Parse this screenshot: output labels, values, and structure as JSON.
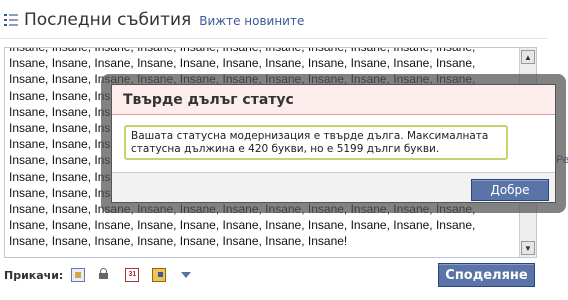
{
  "header": {
    "title": "Последни събития",
    "newest_link": "Вижте новините"
  },
  "composer": {
    "textarea_value": "Insane, Insane, Insane, Insane, Insane, Insane, Insane, Insane, Insane, Insane, Insane, Insane, Insane, Insane, Insane, Insane, Insane, Insane, Insane, Insane, Insane, Insane, Insane, Insane, Insane, Insane, Insane, Insane, Insane, Insane, Insane, Insane, Insane, Insane, Insane, Insane, Insane, Insane, Insane, Insane, Insane, Insane, Insane, Insane, Insane, Insane, Insane, Insane, Insane, Insane, Insane, Insane, Insane, Insane, Insane, Insane, Insane, Insane, Insane, Insane, Insane, Insane, Insane, Insane, Insane, Insane, Insane, Insane, Insane, Insane, Insane, Insane, Insane, Insane, Insane, Insane, Insane, Insane, Insane, Insane, Insane, Insane, Insane, Insane, Insane, Insane, Insane, Insane, Insane, Insane, Insane, Insane, Insane, Insane, Insane, Insane, Insane, Insane, Insane, Insane, Insane, Insane, Insane, Insane, Insane, Insane, Insane, Insane, Insane, Insane, Insane, Insane, Insane, Insane, Insane, Insane, Insane, Insane, Insane, Insane, Insane, Insane, Insane, Insane, Insane, Insane, Insane, Insane, Insane, Insane, Insane, Insane, Insane, Insane, Insane, Insane, Insane, Insane, Insane, Insane!",
    "attach_label": "Прикачи:",
    "share_label": "Споделяне",
    "event_icon_text": "31",
    "right_peek_text": "Ре"
  },
  "dialog": {
    "title": "Твърде дълъг статус",
    "message": "Вашата статусна модернизация е твърде дълга. Максималната статусна дължина е 420 букви, но е 5199 дълги букви.",
    "ok_label": "Добре"
  },
  "icons": {
    "feed": "news-feed-icon",
    "photo": "photo-icon",
    "video": "video-camera-icon",
    "event": "calendar-icon",
    "link": "link-icon",
    "more": "chevron-down-icon"
  },
  "colors": {
    "brand": "#3b5998",
    "button": "#5b74a8",
    "dialog_title_bg": "#fdecec",
    "message_border": "#c4d46b"
  }
}
